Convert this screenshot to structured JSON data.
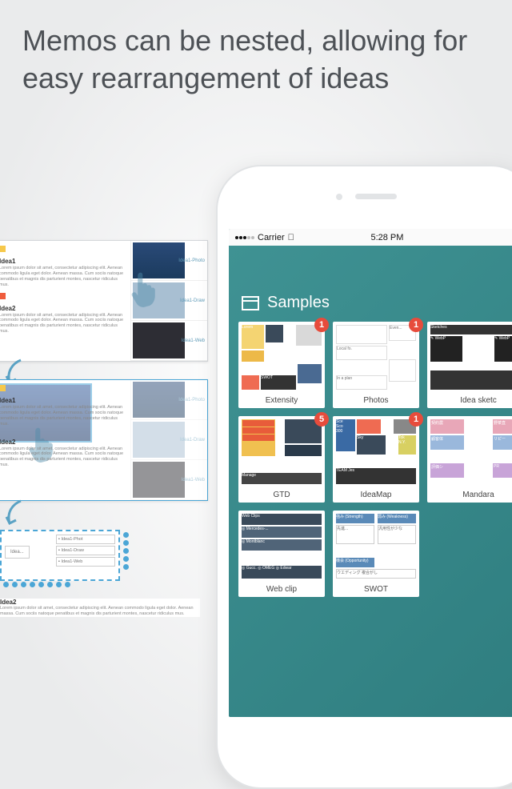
{
  "headline": "Memos can be nested, allowing for easy rearrangement of ideas",
  "tutorial": {
    "idea1": "Idea1",
    "idea2": "Idea2",
    "lorem": "Lorem ipsum dolor sit amet, consectetur adipiscing elit. Aenean commodo ligula eget dolor. Aenean massa. Cum sociis natoque penatibus et magnis dis parturient montes, nascetur ridiculus mus.",
    "thumbPhoto": "Idea1-Photo",
    "thumbDraw": "Idea1-Draw",
    "thumbWeb": "Idea1-Web",
    "targetIdea": "Idea...",
    "miniPhot": "Idea1-Phot",
    "miniDraw": "Idea1-Draw",
    "miniWeb": "Idea1-Web"
  },
  "phone": {
    "carrier": "Carrier",
    "time": "5:28 PM",
    "section": "Samples",
    "cards": [
      {
        "title": "Extensity",
        "badge": "1"
      },
      {
        "title": "Photos",
        "badge": "1"
      },
      {
        "title": "Idea sketc",
        "badge": ""
      },
      {
        "title": "GTD",
        "badge": "5"
      },
      {
        "title": "IdeaMap",
        "badge": "1"
      },
      {
        "title": "Mandara",
        "badge": ""
      },
      {
        "title": "Web clip",
        "badge": ""
      },
      {
        "title": "SWOT",
        "badge": ""
      }
    ],
    "ph": {
      "even": "Even...",
      "local": "Local fo.",
      "plan": "In a plan"
    },
    "sw": {
      "str": "強み (Strength)",
      "wk": "弱み (Weakness)",
      "c1": "先進...",
      "c2": "汎用性が少な",
      "op": "機会 (Opportunity)",
      "f": "ウエディング 複合がし"
    },
    "wc": {
      "a": "Web Clips",
      "b": "◎ Mercedes-...",
      "c": "◎ Montblanc",
      "d": "◎ Gucc. ◎ OMEG ◎ Edwar"
    },
    "mn": {
      "a": "契約農",
      "b": "野菜直",
      "c": "顧客体",
      "d": "リピー",
      "e": "評価シ",
      "f": "PR"
    },
    "ext": {
      "lorem": "Lorem",
      "swot": "SWOT"
    }
  }
}
